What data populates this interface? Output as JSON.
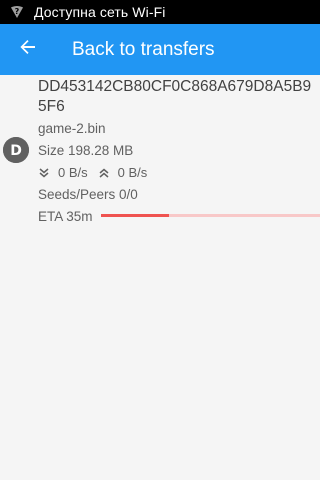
{
  "status_bar": {
    "text": "Доступна сеть Wi-Fi"
  },
  "app_bar": {
    "title": "Back to transfers"
  },
  "torrent": {
    "hash_name": "DD453142CB80CF0C868A679D8A5B95F6",
    "file_name": "game-2.bin",
    "size": "Size 198.28 MB",
    "download_speed": "0 B/s",
    "upload_speed": "0 B/s",
    "seeds_peers": "Seeds/Peers 0/0",
    "eta": "ETA 35m",
    "progress": 0.31
  },
  "colors": {
    "app_bar": "#2196f3",
    "progress_fill": "#ef5350",
    "progress_track": "#f8c8c8",
    "avatar": "#616161"
  },
  "icons": {
    "status_wifi": "wifi-question-icon",
    "back": "arrow-back-icon",
    "avatar": "d-avatar-icon",
    "download": "chevron-double-down-icon",
    "upload": "chevron-double-up-icon"
  }
}
